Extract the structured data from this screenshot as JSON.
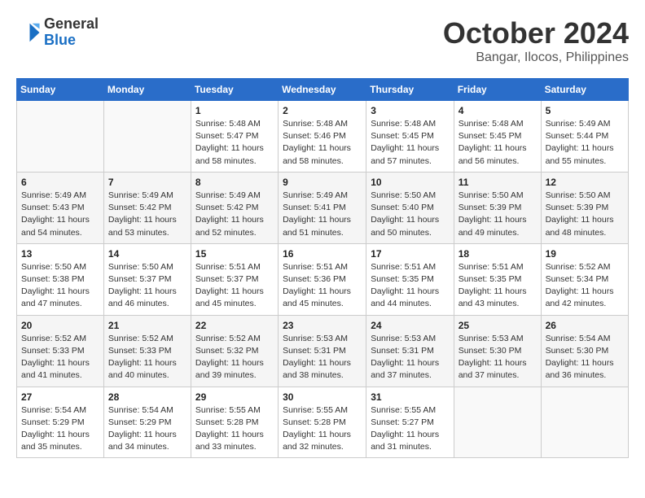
{
  "header": {
    "logo_line1": "General",
    "logo_line2": "Blue",
    "month": "October 2024",
    "location": "Bangar, Ilocos, Philippines"
  },
  "weekdays": [
    "Sunday",
    "Monday",
    "Tuesday",
    "Wednesday",
    "Thursday",
    "Friday",
    "Saturday"
  ],
  "weeks": [
    [
      {
        "day": "",
        "info": ""
      },
      {
        "day": "",
        "info": ""
      },
      {
        "day": "1",
        "info": "Sunrise: 5:48 AM\nSunset: 5:47 PM\nDaylight: 11 hours\nand 58 minutes."
      },
      {
        "day": "2",
        "info": "Sunrise: 5:48 AM\nSunset: 5:46 PM\nDaylight: 11 hours\nand 58 minutes."
      },
      {
        "day": "3",
        "info": "Sunrise: 5:48 AM\nSunset: 5:45 PM\nDaylight: 11 hours\nand 57 minutes."
      },
      {
        "day": "4",
        "info": "Sunrise: 5:48 AM\nSunset: 5:45 PM\nDaylight: 11 hours\nand 56 minutes."
      },
      {
        "day": "5",
        "info": "Sunrise: 5:49 AM\nSunset: 5:44 PM\nDaylight: 11 hours\nand 55 minutes."
      }
    ],
    [
      {
        "day": "6",
        "info": "Sunrise: 5:49 AM\nSunset: 5:43 PM\nDaylight: 11 hours\nand 54 minutes."
      },
      {
        "day": "7",
        "info": "Sunrise: 5:49 AM\nSunset: 5:42 PM\nDaylight: 11 hours\nand 53 minutes."
      },
      {
        "day": "8",
        "info": "Sunrise: 5:49 AM\nSunset: 5:42 PM\nDaylight: 11 hours\nand 52 minutes."
      },
      {
        "day": "9",
        "info": "Sunrise: 5:49 AM\nSunset: 5:41 PM\nDaylight: 11 hours\nand 51 minutes."
      },
      {
        "day": "10",
        "info": "Sunrise: 5:50 AM\nSunset: 5:40 PM\nDaylight: 11 hours\nand 50 minutes."
      },
      {
        "day": "11",
        "info": "Sunrise: 5:50 AM\nSunset: 5:39 PM\nDaylight: 11 hours\nand 49 minutes."
      },
      {
        "day": "12",
        "info": "Sunrise: 5:50 AM\nSunset: 5:39 PM\nDaylight: 11 hours\nand 48 minutes."
      }
    ],
    [
      {
        "day": "13",
        "info": "Sunrise: 5:50 AM\nSunset: 5:38 PM\nDaylight: 11 hours\nand 47 minutes."
      },
      {
        "day": "14",
        "info": "Sunrise: 5:50 AM\nSunset: 5:37 PM\nDaylight: 11 hours\nand 46 minutes."
      },
      {
        "day": "15",
        "info": "Sunrise: 5:51 AM\nSunset: 5:37 PM\nDaylight: 11 hours\nand 45 minutes."
      },
      {
        "day": "16",
        "info": "Sunrise: 5:51 AM\nSunset: 5:36 PM\nDaylight: 11 hours\nand 45 minutes."
      },
      {
        "day": "17",
        "info": "Sunrise: 5:51 AM\nSunset: 5:35 PM\nDaylight: 11 hours\nand 44 minutes."
      },
      {
        "day": "18",
        "info": "Sunrise: 5:51 AM\nSunset: 5:35 PM\nDaylight: 11 hours\nand 43 minutes."
      },
      {
        "day": "19",
        "info": "Sunrise: 5:52 AM\nSunset: 5:34 PM\nDaylight: 11 hours\nand 42 minutes."
      }
    ],
    [
      {
        "day": "20",
        "info": "Sunrise: 5:52 AM\nSunset: 5:33 PM\nDaylight: 11 hours\nand 41 minutes."
      },
      {
        "day": "21",
        "info": "Sunrise: 5:52 AM\nSunset: 5:33 PM\nDaylight: 11 hours\nand 40 minutes."
      },
      {
        "day": "22",
        "info": "Sunrise: 5:52 AM\nSunset: 5:32 PM\nDaylight: 11 hours\nand 39 minutes."
      },
      {
        "day": "23",
        "info": "Sunrise: 5:53 AM\nSunset: 5:31 PM\nDaylight: 11 hours\nand 38 minutes."
      },
      {
        "day": "24",
        "info": "Sunrise: 5:53 AM\nSunset: 5:31 PM\nDaylight: 11 hours\nand 37 minutes."
      },
      {
        "day": "25",
        "info": "Sunrise: 5:53 AM\nSunset: 5:30 PM\nDaylight: 11 hours\nand 37 minutes."
      },
      {
        "day": "26",
        "info": "Sunrise: 5:54 AM\nSunset: 5:30 PM\nDaylight: 11 hours\nand 36 minutes."
      }
    ],
    [
      {
        "day": "27",
        "info": "Sunrise: 5:54 AM\nSunset: 5:29 PM\nDaylight: 11 hours\nand 35 minutes."
      },
      {
        "day": "28",
        "info": "Sunrise: 5:54 AM\nSunset: 5:29 PM\nDaylight: 11 hours\nand 34 minutes."
      },
      {
        "day": "29",
        "info": "Sunrise: 5:55 AM\nSunset: 5:28 PM\nDaylight: 11 hours\nand 33 minutes."
      },
      {
        "day": "30",
        "info": "Sunrise: 5:55 AM\nSunset: 5:28 PM\nDaylight: 11 hours\nand 32 minutes."
      },
      {
        "day": "31",
        "info": "Sunrise: 5:55 AM\nSunset: 5:27 PM\nDaylight: 11 hours\nand 31 minutes."
      },
      {
        "day": "",
        "info": ""
      },
      {
        "day": "",
        "info": ""
      }
    ]
  ]
}
